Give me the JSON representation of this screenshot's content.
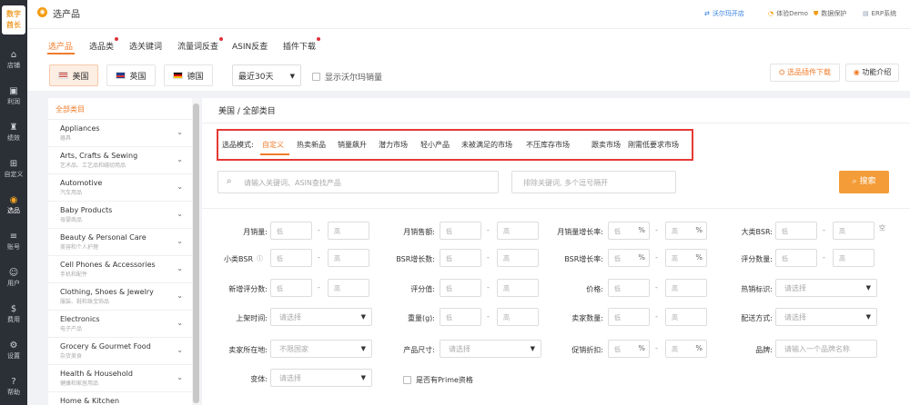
{
  "app": {
    "logo_line1": "数字",
    "logo_line2": "酋长",
    "rail": [
      {
        "icon": "home-icon",
        "glyph": "⌂",
        "label": "店铺"
      },
      {
        "icon": "wallet-icon",
        "glyph": "▣",
        "label": "利润"
      },
      {
        "icon": "trophy-icon",
        "glyph": "♜",
        "label": "绩效"
      },
      {
        "icon": "grid-icon",
        "glyph": "⊞",
        "label": "自定义"
      },
      {
        "icon": "product-icon",
        "glyph": "◉",
        "label": "选品"
      },
      {
        "icon": "list-icon",
        "glyph": "≡",
        "label": "账号"
      },
      {
        "icon": "user-icon",
        "glyph": "☺",
        "label": "用户"
      },
      {
        "icon": "dollar-icon",
        "glyph": "$",
        "label": "费用"
      },
      {
        "icon": "gear-icon",
        "glyph": "⚙",
        "label": "设置"
      },
      {
        "icon": "help-icon",
        "glyph": "?",
        "label": "帮助"
      }
    ]
  },
  "header": {
    "title": "选产品",
    "links": [
      "沃尔玛开店",
      "体验Demo",
      "数据保护",
      "ERP系统"
    ]
  },
  "tabs": [
    {
      "label": "选产品",
      "dot": false
    },
    {
      "label": "选品类",
      "dot": true
    },
    {
      "label": "选关键词",
      "dot": false
    },
    {
      "label": "流量词反查",
      "dot": true
    },
    {
      "label": "ASIN反查",
      "dot": false
    },
    {
      "label": "插件下载",
      "dot": true
    }
  ],
  "toolbar": {
    "countries": [
      "美国",
      "英国",
      "德国"
    ],
    "date_range": "最近30天",
    "walmart_label": "显示沃尔玛销量",
    "plugin_btn": "选品插件下载",
    "intro_btn": "功能介绍"
  },
  "categories": {
    "header": "全部类目",
    "items": [
      {
        "en": "Appliances",
        "cn": "器具"
      },
      {
        "en": "Arts, Crafts & Sewing",
        "cn": "艺术品、工艺品和缝纫用品"
      },
      {
        "en": "Automotive",
        "cn": "汽车用品"
      },
      {
        "en": "Baby Products",
        "cn": "母婴商品"
      },
      {
        "en": "Beauty & Personal Care",
        "cn": "美容和个人护理"
      },
      {
        "en": "Cell Phones & Accessories",
        "cn": "手机和配件"
      },
      {
        "en": "Clothing, Shoes & Jewelry",
        "cn": "服装、鞋和珠宝饰品"
      },
      {
        "en": "Electronics",
        "cn": "电子产品"
      },
      {
        "en": "Grocery & Gourmet Food",
        "cn": "杂货美食"
      },
      {
        "en": "Health & Household",
        "cn": "健康和家居用品"
      },
      {
        "en": "Home & Kitchen",
        "cn": ""
      }
    ]
  },
  "main": {
    "breadcrumb": "美国 / 全部类目",
    "mode_label": "选品模式:",
    "modes": [
      "自定义",
      "热卖新品",
      "销量飙升",
      "潜力市场",
      "轻小产品",
      "未被满足的市场",
      "不压库存市场",
      "跟卖市场",
      "刚需低要求市场"
    ],
    "keyword_placeholder": "请输入关键词、ASIN查找产品",
    "exclude_placeholder": "排除关键词, 多个逗号隔开",
    "search_btn": "搜索",
    "edge_text": "空"
  },
  "filters": {
    "dash": "-",
    "low": "低",
    "high": "高",
    "pct": "%",
    "select_placeholder": "请选择",
    "labels": {
      "monthly_sales": "月销量:",
      "monthly_revenue": "月销售额:",
      "sales_growth": "月销量增长率:",
      "main_bsr": "大类BSR:",
      "sub_bsr": "小类BSR",
      "bsr_growth": "BSR增长数:",
      "bsr_growth_rate": "BSR增长率:",
      "rating_count": "评分数量:",
      "new_ratings": "新增评分数:",
      "rating": "评分值:",
      "price": "价格:",
      "hot_tag": "热销标识:",
      "listing_time": "上架时间:",
      "weight": "重量(g):",
      "seller_count": "卖家数量:",
      "fulfillment": "配送方式:",
      "seller_location": "卖家所在地:",
      "product_size": "产品尺寸:",
      "discount": "促销折扣:",
      "brand": "品牌:",
      "variant": "变体:"
    },
    "seller_location_value": "不限国家",
    "brand_placeholder": "请输入一个品牌名称",
    "prime_label": "是否有Prime资格"
  }
}
